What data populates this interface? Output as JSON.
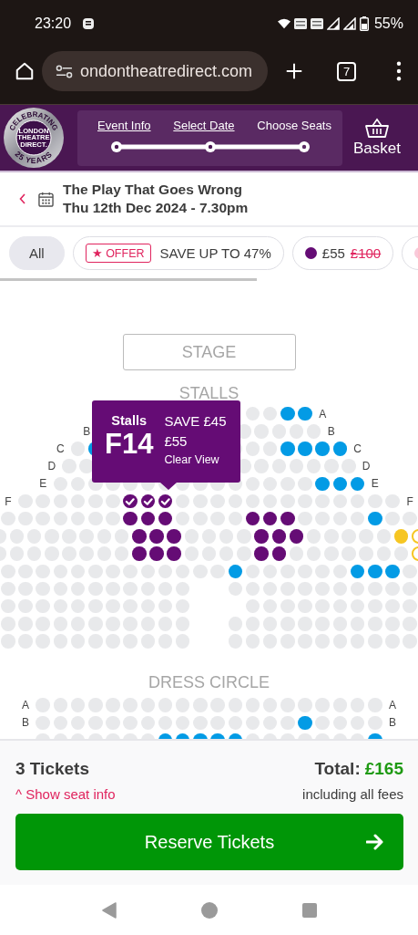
{
  "status_bar": {
    "time": "23:20",
    "battery": "55%"
  },
  "browser": {
    "url": "ondontheatredirect.com",
    "tab_count": "7"
  },
  "header": {
    "logo": {
      "ring_top": "CELEBRATING",
      "ring_bottom": "25 YEARS",
      "lines": [
        "LONDON",
        "THEATRE",
        "DIRECT."
      ]
    },
    "steps": [
      {
        "label": "Event Info",
        "selected": false
      },
      {
        "label": "Select Date",
        "selected": false
      },
      {
        "label": "Choose Seats",
        "selected": true
      }
    ],
    "basket": "Basket"
  },
  "event": {
    "title": "The Play That Goes Wrong",
    "date": "Thu 12th Dec 2024 - 7.30pm"
  },
  "filters": [
    {
      "kind": "all",
      "label": "All",
      "selected": true
    },
    {
      "kind": "offer",
      "badge": "★ OFFER",
      "label": "SAVE UP TO 47%",
      "selected": false
    },
    {
      "kind": "price",
      "color": "#650c75",
      "price": "£55",
      "old_price": "£100",
      "selected": false
    },
    {
      "kind": "price",
      "color": "#f9c9d9",
      "selected": false
    }
  ],
  "seat_map": {
    "stage": "STAGE",
    "sections": [
      {
        "name": "STALLS",
        "rows": [
          {
            "right": "A",
            "seats": [
              {
                "kind": "gap"
              },
              {
                "kind": "gap"
              },
              {
                "kind": "gap"
              },
              {
                "kind": "gap"
              },
              {
                "kind": "gap"
              },
              {
                "kind": "gap"
              },
              {
                "kind": "gap"
              },
              {
                "kind": "gap"
              },
              {
                "kind": "taken"
              },
              {
                "kind": "taken"
              },
              {
                "kind": "free",
                "color": "#039be5",
                "selected": false
              },
              {
                "kind": "free",
                "color": "#039be5",
                "selected": false
              }
            ]
          },
          {
            "left": "B",
            "right": "B",
            "seats": [
              {
                "kind": "gap"
              },
              {
                "kind": "gap"
              },
              {
                "kind": "gap"
              },
              {
                "kind": "gap"
              },
              {
                "kind": "gap"
              },
              {
                "kind": "gap"
              },
              {
                "kind": "gap"
              },
              {
                "kind": "gap"
              },
              {
                "kind": "taken"
              },
              {
                "kind": "taken"
              },
              {
                "kind": "taken"
              },
              {
                "kind": "taken"
              },
              {
                "kind": "taken"
              }
            ]
          },
          {
            "left": "C",
            "right": "C",
            "seats": [
              {
                "kind": "taken"
              },
              {
                "kind": "free",
                "color": "#039be5",
                "selected": false
              },
              {
                "kind": "gap"
              },
              {
                "kind": "gap"
              },
              {
                "kind": "gap"
              },
              {
                "kind": "gap"
              },
              {
                "kind": "gap"
              },
              {
                "kind": "gap"
              },
              {
                "kind": "gap"
              },
              {
                "kind": "taken"
              },
              {
                "kind": "taken"
              },
              {
                "kind": "taken"
              },
              {
                "kind": "free",
                "color": "#039be5",
                "selected": false
              },
              {
                "kind": "free",
                "color": "#039be5",
                "selected": false
              },
              {
                "kind": "free",
                "color": "#039be5",
                "selected": false
              },
              {
                "kind": "free",
                "color": "#039be5",
                "selected": false
              }
            ]
          },
          {
            "left": "D",
            "right": "D",
            "seats": [
              {
                "kind": "taken"
              },
              {
                "kind": "taken"
              },
              {
                "kind": "gap"
              },
              {
                "kind": "gap"
              },
              {
                "kind": "gap"
              },
              {
                "kind": "gap"
              },
              {
                "kind": "gap"
              },
              {
                "kind": "gap"
              },
              {
                "kind": "gap"
              },
              {
                "kind": "gap"
              },
              {
                "kind": "taken"
              },
              {
                "kind": "taken"
              },
              {
                "kind": "taken"
              },
              {
                "kind": "taken"
              },
              {
                "kind": "taken"
              },
              {
                "kind": "taken"
              },
              {
                "kind": "taken"
              }
            ]
          },
          {
            "left": "E",
            "right": "E",
            "seats": [
              {
                "kind": "taken"
              },
              {
                "kind": "taken"
              },
              {
                "kind": "taken"
              },
              {
                "kind": "taken"
              },
              {
                "kind": "taken"
              },
              {
                "kind": "taken"
              },
              {
                "kind": "taken"
              },
              {
                "kind": "taken"
              },
              {
                "kind": "taken"
              },
              {
                "kind": "taken"
              },
              {
                "kind": "taken"
              },
              {
                "kind": "taken"
              },
              {
                "kind": "taken"
              },
              {
                "kind": "taken"
              },
              {
                "kind": "taken"
              },
              {
                "kind": "free",
                "color": "#039be5",
                "selected": false
              },
              {
                "kind": "free",
                "color": "#039be5",
                "selected": false
              },
              {
                "kind": "free",
                "color": "#039be5",
                "selected": false
              }
            ]
          },
          {
            "left": "F",
            "right": "F",
            "seats": [
              {
                "kind": "taken"
              },
              {
                "kind": "taken"
              },
              {
                "kind": "taken"
              },
              {
                "kind": "taken"
              },
              {
                "kind": "taken"
              },
              {
                "kind": "taken"
              },
              {
                "kind": "free",
                "color": "#650c75",
                "selected": true
              },
              {
                "kind": "free",
                "color": "#650c75",
                "selected": true
              },
              {
                "kind": "free",
                "color": "#650c75",
                "selected": true
              },
              {
                "kind": "taken"
              },
              {
                "kind": "taken"
              },
              {
                "kind": "taken"
              },
              {
                "kind": "taken"
              },
              {
                "kind": "taken"
              },
              {
                "kind": "taken"
              },
              {
                "kind": "taken"
              },
              {
                "kind": "taken"
              },
              {
                "kind": "taken"
              },
              {
                "kind": "taken"
              },
              {
                "kind": "taken"
              },
              {
                "kind": "taken"
              },
              {
                "kind": "taken"
              }
            ]
          },
          {
            "seats": [
              {
                "kind": "taken"
              },
              {
                "kind": "taken"
              },
              {
                "kind": "taken"
              },
              {
                "kind": "taken"
              },
              {
                "kind": "taken"
              },
              {
                "kind": "taken"
              },
              {
                "kind": "taken"
              },
              {
                "kind": "free",
                "color": "#650c75",
                "selected": false
              },
              {
                "kind": "free",
                "color": "#650c75",
                "selected": false
              },
              {
                "kind": "free",
                "color": "#650c75",
                "selected": false
              },
              {
                "kind": "taken"
              },
              {
                "kind": "taken"
              },
              {
                "kind": "taken"
              },
              {
                "kind": "taken"
              },
              {
                "kind": "free",
                "color": "#650c75",
                "selected": false
              },
              {
                "kind": "free",
                "color": "#650c75",
                "selected": false
              },
              {
                "kind": "free",
                "color": "#650c75",
                "selected": false
              },
              {
                "kind": "taken"
              },
              {
                "kind": "taken"
              },
              {
                "kind": "taken"
              },
              {
                "kind": "taken"
              },
              {
                "kind": "free",
                "color": "#039be5",
                "selected": false
              },
              {
                "kind": "taken"
              },
              {
                "kind": "taken"
              }
            ]
          },
          {
            "seats": [
              {
                "kind": "taken"
              },
              {
                "kind": "taken"
              },
              {
                "kind": "taken"
              },
              {
                "kind": "taken"
              },
              {
                "kind": "taken"
              },
              {
                "kind": "taken"
              },
              {
                "kind": "taken"
              },
              {
                "kind": "taken"
              },
              {
                "kind": "free",
                "color": "#650c75",
                "selected": false
              },
              {
                "kind": "free",
                "color": "#650c75",
                "selected": false
              },
              {
                "kind": "free",
                "color": "#650c75",
                "selected": false
              },
              {
                "kind": "taken"
              },
              {
                "kind": "taken"
              },
              {
                "kind": "taken"
              },
              {
                "kind": "taken"
              },
              {
                "kind": "free",
                "color": "#650c75",
                "selected": false
              },
              {
                "kind": "free",
                "color": "#650c75",
                "selected": false
              },
              {
                "kind": "free",
                "color": "#650c75",
                "selected": false
              },
              {
                "kind": "taken"
              },
              {
                "kind": "taken"
              },
              {
                "kind": "taken"
              },
              {
                "kind": "taken"
              },
              {
                "kind": "taken"
              },
              {
                "kind": "free",
                "color": "#f6c623",
                "selected": false
              },
              {
                "kind": "outline",
                "color": "#f6c623",
                "selected": false
              }
            ]
          },
          {
            "seats": [
              {
                "kind": "taken"
              },
              {
                "kind": "taken"
              },
              {
                "kind": "taken"
              },
              {
                "kind": "taken"
              },
              {
                "kind": "taken"
              },
              {
                "kind": "taken"
              },
              {
                "kind": "taken"
              },
              {
                "kind": "taken"
              },
              {
                "kind": "free",
                "color": "#650c75",
                "selected": false
              },
              {
                "kind": "free",
                "color": "#650c75",
                "selected": false
              },
              {
                "kind": "free",
                "color": "#650c75",
                "selected": false
              },
              {
                "kind": "taken"
              },
              {
                "kind": "taken"
              },
              {
                "kind": "taken"
              },
              {
                "kind": "taken"
              },
              {
                "kind": "free",
                "color": "#650c75",
                "selected": false
              },
              {
                "kind": "free",
                "color": "#650c75",
                "selected": false
              },
              {
                "kind": "taken"
              },
              {
                "kind": "taken"
              },
              {
                "kind": "taken"
              },
              {
                "kind": "taken"
              },
              {
                "kind": "taken"
              },
              {
                "kind": "taken"
              },
              {
                "kind": "taken"
              },
              {
                "kind": "outline",
                "color": "#f6c623",
                "selected": false
              }
            ]
          },
          {
            "seats": [
              {
                "kind": "taken"
              },
              {
                "kind": "taken"
              },
              {
                "kind": "taken"
              },
              {
                "kind": "taken"
              },
              {
                "kind": "taken"
              },
              {
                "kind": "taken"
              },
              {
                "kind": "taken"
              },
              {
                "kind": "taken"
              },
              {
                "kind": "taken"
              },
              {
                "kind": "taken"
              },
              {
                "kind": "taken"
              },
              {
                "kind": "taken"
              },
              {
                "kind": "taken"
              },
              {
                "kind": "free",
                "color": "#039be5",
                "selected": false
              },
              {
                "kind": "taken"
              },
              {
                "kind": "taken"
              },
              {
                "kind": "taken"
              },
              {
                "kind": "taken"
              },
              {
                "kind": "taken"
              },
              {
                "kind": "taken"
              },
              {
                "kind": "free",
                "color": "#039be5",
                "selected": false
              },
              {
                "kind": "free",
                "color": "#039be5",
                "selected": false
              },
              {
                "kind": "free",
                "color": "#039be5",
                "selected": false
              },
              {
                "kind": "taken"
              }
            ]
          },
          {
            "seats": [
              {
                "kind": "taken"
              },
              {
                "kind": "taken"
              },
              {
                "kind": "taken"
              },
              {
                "kind": "taken"
              },
              {
                "kind": "taken"
              },
              {
                "kind": "taken"
              },
              {
                "kind": "taken"
              },
              {
                "kind": "taken"
              },
              {
                "kind": "taken"
              },
              {
                "kind": "taken"
              },
              {
                "kind": "taken"
              },
              {
                "kind": "gap"
              },
              {
                "kind": "gap"
              },
              {
                "kind": "taken"
              },
              {
                "kind": "taken"
              },
              {
                "kind": "taken"
              },
              {
                "kind": "taken"
              },
              {
                "kind": "taken"
              },
              {
                "kind": "taken"
              },
              {
                "kind": "taken"
              },
              {
                "kind": "taken"
              },
              {
                "kind": "taken"
              },
              {
                "kind": "taken"
              },
              {
                "kind": "taken"
              }
            ]
          },
          {
            "seats": [
              {
                "kind": "taken"
              },
              {
                "kind": "taken"
              },
              {
                "kind": "taken"
              },
              {
                "kind": "taken"
              },
              {
                "kind": "taken"
              },
              {
                "kind": "taken"
              },
              {
                "kind": "taken"
              },
              {
                "kind": "taken"
              },
              {
                "kind": "taken"
              },
              {
                "kind": "taken"
              },
              {
                "kind": "taken"
              },
              {
                "kind": "gap"
              },
              {
                "kind": "gap"
              },
              {
                "kind": "gap"
              },
              {
                "kind": "taken"
              },
              {
                "kind": "taken"
              },
              {
                "kind": "taken"
              },
              {
                "kind": "taken"
              },
              {
                "kind": "taken"
              },
              {
                "kind": "taken"
              },
              {
                "kind": "taken"
              },
              {
                "kind": "taken"
              },
              {
                "kind": "taken"
              },
              {
                "kind": "taken"
              }
            ]
          },
          {
            "seats": [
              {
                "kind": "taken"
              },
              {
                "kind": "taken"
              },
              {
                "kind": "taken"
              },
              {
                "kind": "taken"
              },
              {
                "kind": "taken"
              },
              {
                "kind": "taken"
              },
              {
                "kind": "taken"
              },
              {
                "kind": "taken"
              },
              {
                "kind": "taken"
              },
              {
                "kind": "taken"
              },
              {
                "kind": "taken"
              },
              {
                "kind": "gap"
              },
              {
                "kind": "gap"
              },
              {
                "kind": "taken"
              },
              {
                "kind": "taken"
              },
              {
                "kind": "taken"
              },
              {
                "kind": "taken"
              },
              {
                "kind": "taken"
              },
              {
                "kind": "taken"
              },
              {
                "kind": "taken"
              },
              {
                "kind": "taken"
              },
              {
                "kind": "taken"
              },
              {
                "kind": "taken"
              },
              {
                "kind": "taken"
              }
            ]
          },
          {
            "seats": [
              {
                "kind": "taken"
              },
              {
                "kind": "taken"
              },
              {
                "kind": "taken"
              },
              {
                "kind": "taken"
              },
              {
                "kind": "taken"
              },
              {
                "kind": "taken"
              },
              {
                "kind": "taken"
              },
              {
                "kind": "taken"
              },
              {
                "kind": "taken"
              },
              {
                "kind": "taken"
              },
              {
                "kind": "taken"
              },
              {
                "kind": "gap"
              },
              {
                "kind": "gap"
              },
              {
                "kind": "taken"
              },
              {
                "kind": "taken"
              },
              {
                "kind": "taken"
              },
              {
                "kind": "taken"
              },
              {
                "kind": "taken"
              },
              {
                "kind": "taken"
              },
              {
                "kind": "taken"
              },
              {
                "kind": "taken"
              },
              {
                "kind": "taken"
              },
              {
                "kind": "taken"
              },
              {
                "kind": "taken"
              }
            ]
          }
        ]
      },
      {
        "name": "DRESS CIRCLE",
        "rows": [
          {
            "left": "A",
            "right": "A",
            "seats": [
              {
                "kind": "taken"
              },
              {
                "kind": "taken"
              },
              {
                "kind": "taken"
              },
              {
                "kind": "taken"
              },
              {
                "kind": "taken"
              },
              {
                "kind": "taken"
              },
              {
                "kind": "taken"
              },
              {
                "kind": "taken"
              },
              {
                "kind": "taken"
              },
              {
                "kind": "taken"
              },
              {
                "kind": "taken"
              },
              {
                "kind": "taken"
              },
              {
                "kind": "taken"
              },
              {
                "kind": "taken"
              },
              {
                "kind": "taken"
              },
              {
                "kind": "taken"
              },
              {
                "kind": "taken"
              },
              {
                "kind": "taken"
              },
              {
                "kind": "taken"
              },
              {
                "kind": "taken"
              }
            ]
          },
          {
            "left": "B",
            "right": "B",
            "seats": [
              {
                "kind": "taken"
              },
              {
                "kind": "taken"
              },
              {
                "kind": "taken"
              },
              {
                "kind": "taken"
              },
              {
                "kind": "taken"
              },
              {
                "kind": "taken"
              },
              {
                "kind": "taken"
              },
              {
                "kind": "taken"
              },
              {
                "kind": "taken"
              },
              {
                "kind": "taken"
              },
              {
                "kind": "taken"
              },
              {
                "kind": "taken"
              },
              {
                "kind": "taken"
              },
              {
                "kind": "taken"
              },
              {
                "kind": "taken"
              },
              {
                "kind": "free",
                "color": "#039be5",
                "selected": false
              },
              {
                "kind": "taken"
              },
              {
                "kind": "taken"
              },
              {
                "kind": "taken"
              },
              {
                "kind": "taken"
              }
            ]
          },
          {
            "seats": [
              {
                "kind": "taken"
              },
              {
                "kind": "taken"
              },
              {
                "kind": "taken"
              },
              {
                "kind": "taken"
              },
              {
                "kind": "taken"
              },
              {
                "kind": "taken"
              },
              {
                "kind": "taken"
              },
              {
                "kind": "free",
                "color": "#039be5",
                "selected": false
              },
              {
                "kind": "free",
                "color": "#039be5",
                "selected": false
              },
              {
                "kind": "free",
                "color": "#039be5",
                "selected": false
              },
              {
                "kind": "free",
                "color": "#039be5",
                "selected": false
              },
              {
                "kind": "free",
                "color": "#039be5",
                "selected": false
              },
              {
                "kind": "taken"
              },
              {
                "kind": "taken"
              },
              {
                "kind": "taken"
              },
              {
                "kind": "taken"
              },
              {
                "kind": "taken"
              },
              {
                "kind": "taken"
              },
              {
                "kind": "taken"
              },
              {
                "kind": "free",
                "color": "#039be5",
                "selected": false
              }
            ]
          }
        ]
      }
    ],
    "tooltip": {
      "section": "Stalls",
      "seat": "F14",
      "saving": "SAVE £45",
      "price": "£55",
      "view": "Clear View"
    }
  },
  "footer": {
    "tickets": "3 Tickets",
    "seat_info_link": "^ Show seat info",
    "total_label": "Total:",
    "total": "£165",
    "fees_note": "including all fees",
    "button": "Reserve Tickets"
  }
}
